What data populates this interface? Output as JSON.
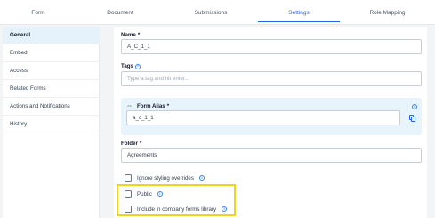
{
  "tabs": [
    {
      "label": "Form",
      "active": false
    },
    {
      "label": "Document",
      "active": false
    },
    {
      "label": "Submissions",
      "active": false
    },
    {
      "label": "Settings",
      "active": true
    },
    {
      "label": "Role Mapping",
      "active": false
    }
  ],
  "sidebar": {
    "items": [
      {
        "label": "General",
        "active": true
      },
      {
        "label": "Embed",
        "active": false
      },
      {
        "label": "Access",
        "active": false
      },
      {
        "label": "Related Forms",
        "active": false
      },
      {
        "label": "Actions and Notifications",
        "active": false
      },
      {
        "label": "History",
        "active": false
      }
    ]
  },
  "form": {
    "name": {
      "label": "Name",
      "required_mark": "*",
      "value": "A_C_1_1"
    },
    "tags": {
      "label": "Tags",
      "placeholder": "Type a tag and hit enter..."
    },
    "alias": {
      "label": "Form Alias",
      "required_mark": "*",
      "value": "a_c_1_1"
    },
    "folder": {
      "label": "Folder",
      "required_mark": "*",
      "value": "Agreements"
    },
    "checkboxes": [
      {
        "label": "Ignore styling overrides",
        "checked": false
      },
      {
        "label": "Public",
        "checked": false
      },
      {
        "label": "Include in company forms library",
        "checked": false
      }
    ]
  },
  "colors": {
    "accent": "#2563eb",
    "highlight": "#f2d31b",
    "alias_bg": "#e8f4fc",
    "active_sidebar": "#e6f2fb"
  },
  "icons": {
    "info": "info-circle-icon",
    "copy": "copy-icon",
    "alias": "double-arrow-icon"
  }
}
